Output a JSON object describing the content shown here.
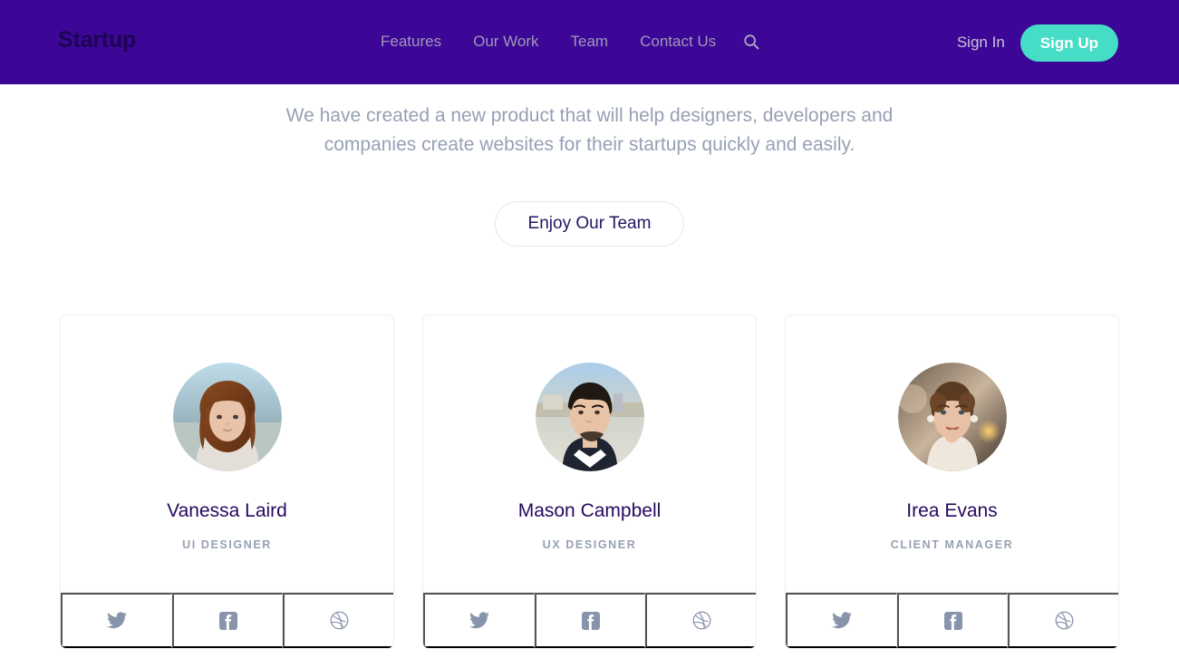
{
  "header": {
    "logo": "Startup",
    "nav": [
      {
        "label": "Features",
        "name": "nav-link-features"
      },
      {
        "label": "Our Work",
        "name": "nav-link-our-work"
      },
      {
        "label": "Team",
        "name": "nav-link-team"
      },
      {
        "label": "Contact Us",
        "name": "nav-link-contact-us"
      }
    ],
    "search_icon": "search-icon",
    "sign_in": "Sign In",
    "sign_up": "Sign Up",
    "bg_color": "#3c0696",
    "signup_color": "#45ddc5",
    "nav_link_color": "#a099b8"
  },
  "hero": {
    "description_line1": "We have created a new product that will help designers, developers and",
    "description_line2": "companies create websites for their startups quickly and easily.",
    "cta_label": "Enjoy Our Team",
    "text_color": "#96a0b5"
  },
  "team": {
    "members": [
      {
        "name": "Vanessa Laird",
        "role": "UI DESIGNER",
        "avatar_alt": "portrait-woman-red-hair",
        "socials": [
          {
            "icon": "twitter-icon",
            "label": "Twitter"
          },
          {
            "icon": "facebook-icon",
            "label": "Facebook"
          },
          {
            "icon": "dribbble-icon",
            "label": "Dribbble"
          }
        ]
      },
      {
        "name": "Mason Campbell",
        "role": "UX DESIGNER",
        "avatar_alt": "portrait-man-beard",
        "socials": [
          {
            "icon": "twitter-icon",
            "label": "Twitter"
          },
          {
            "icon": "facebook-icon",
            "label": "Facebook"
          },
          {
            "icon": "dribbble-icon",
            "label": "Dribbble"
          }
        ]
      },
      {
        "name": "Irea Evans",
        "role": "CLIENT MANAGER",
        "avatar_alt": "portrait-woman-updo",
        "socials": [
          {
            "icon": "twitter-icon",
            "label": "Twitter"
          },
          {
            "icon": "facebook-icon",
            "label": "Facebook"
          },
          {
            "icon": "dribbble-icon",
            "label": "Dribbble"
          }
        ]
      }
    ],
    "name_color": "#27095f",
    "role_color": "#97a0b4",
    "social_icon_color": "#8894ab",
    "card_border_color": "#eeeef1"
  }
}
